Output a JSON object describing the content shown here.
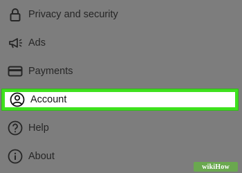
{
  "menu": {
    "items": [
      {
        "label": "Privacy and security",
        "icon": "lock-icon"
      },
      {
        "label": "Ads",
        "icon": "megaphone-icon"
      },
      {
        "label": "Payments",
        "icon": "card-icon"
      },
      {
        "label": "Account",
        "icon": "account-icon",
        "selected": true
      },
      {
        "label": "Help",
        "icon": "help-icon"
      },
      {
        "label": "About",
        "icon": "info-icon"
      }
    ]
  },
  "colors": {
    "background": "#7d7d7d",
    "highlight_border": "#3fe11e",
    "text": "#262626"
  },
  "watermark": {
    "text": "wikiHow"
  }
}
